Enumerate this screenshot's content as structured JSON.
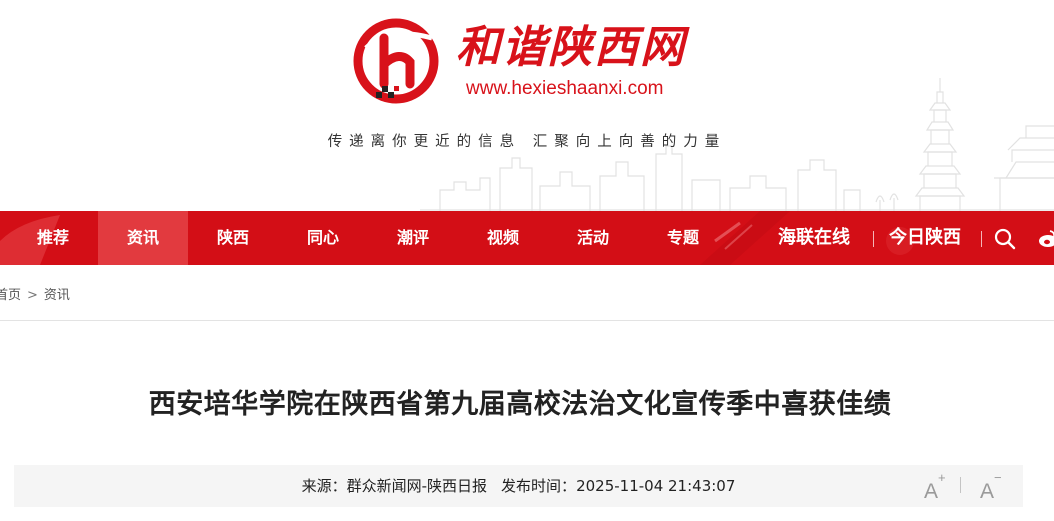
{
  "header": {
    "logo_text": "和谐陕西网",
    "logo_url": "www.hexieshaanxi.com",
    "slogan": "传递离你更近的信息 汇聚向上向善的力量"
  },
  "nav": {
    "items": [
      {
        "label": "推荐",
        "active": false
      },
      {
        "label": "资讯",
        "active": true
      },
      {
        "label": "陕西",
        "active": false
      },
      {
        "label": "同心",
        "active": false
      },
      {
        "label": "潮评",
        "active": false
      },
      {
        "label": "视频",
        "active": false
      },
      {
        "label": "活动",
        "active": false
      },
      {
        "label": "专题",
        "active": false
      }
    ],
    "right_title_1": "海联在线",
    "right_title_2": "今日陕西",
    "search_icon": "search-icon",
    "weibo_icon": "weibo-icon"
  },
  "breadcrumb": {
    "home": "首页",
    "separator": ">",
    "current": "资讯"
  },
  "article": {
    "title": "西安培华学院在陕西省第九届高校法治文化宣传季中喜获佳绩",
    "source_label": "来源：",
    "source": "群众新闻网-陕西日报",
    "time_label": "发布时间：",
    "time": "2025-11-04 21:43:07",
    "font_increase": "A",
    "font_increase_sign": "+",
    "font_decrease": "A",
    "font_decrease_sign": "−"
  },
  "colors": {
    "brand_red": "#d30e16",
    "nav_active": "#e23a3f"
  }
}
